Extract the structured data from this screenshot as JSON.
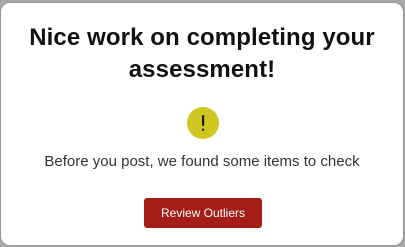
{
  "dialog": {
    "title": "Nice work on completing your assessment!",
    "icon": "exclamation-icon",
    "message": "Before you post, we found some items to check",
    "primary_button_label": "Review Outliers"
  },
  "colors": {
    "accent_button": "#a41d16",
    "warning_icon": "#cfc621",
    "title_text": "#111111",
    "body_text": "#333333"
  }
}
